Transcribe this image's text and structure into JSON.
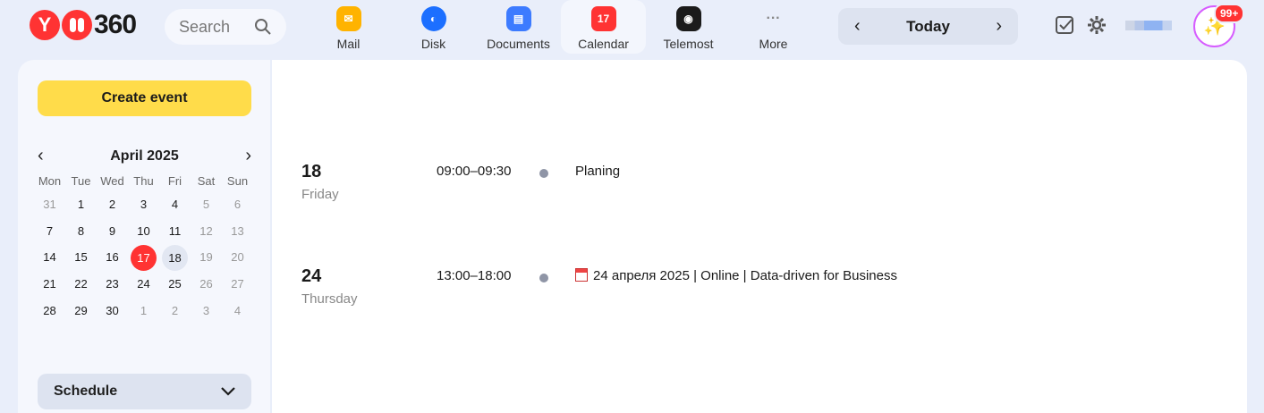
{
  "logo": {
    "yandex_letter": "Y",
    "number": "360"
  },
  "search": {
    "placeholder": "Search"
  },
  "apps": [
    {
      "label": "Mail",
      "icon": "mail-icon"
    },
    {
      "label": "Disk",
      "icon": "disk-icon"
    },
    {
      "label": "Documents",
      "icon": "documents-icon"
    },
    {
      "label": "Calendar",
      "icon": "calendar-icon",
      "badge": "17",
      "active": true
    },
    {
      "label": "Telemost",
      "icon": "telemost-icon"
    },
    {
      "label": "More",
      "icon": "more-icon",
      "glyph": "···"
    }
  ],
  "datenav": {
    "label": "Today",
    "prev": "‹",
    "next": "›"
  },
  "notifications": {
    "count": "99+"
  },
  "sidebar": {
    "create_label": "Create event",
    "month": "April 2025",
    "weekdays": [
      "Mon",
      "Tue",
      "Wed",
      "Thu",
      "Fri",
      "Sat",
      "Sun"
    ],
    "weeks": [
      [
        "31",
        "1",
        "2",
        "3",
        "4",
        "5",
        "6"
      ],
      [
        "7",
        "8",
        "9",
        "10",
        "11",
        "12",
        "13"
      ],
      [
        "14",
        "15",
        "16",
        "17",
        "18",
        "19",
        "20"
      ],
      [
        "21",
        "22",
        "23",
        "24",
        "25",
        "26",
        "27"
      ],
      [
        "28",
        "29",
        "30",
        "1",
        "2",
        "3",
        "4"
      ]
    ],
    "today": "17",
    "selected": "18",
    "schedule_label": "Schedule"
  },
  "events": [
    {
      "day": "18",
      "weekday": "Friday",
      "time": "09:00–09:30",
      "title": "Planing"
    },
    {
      "day": "24",
      "weekday": "Thursday",
      "time": "13:00–18:00",
      "title": "24 апреля 2025 | Online | Data-driven for Business"
    }
  ]
}
